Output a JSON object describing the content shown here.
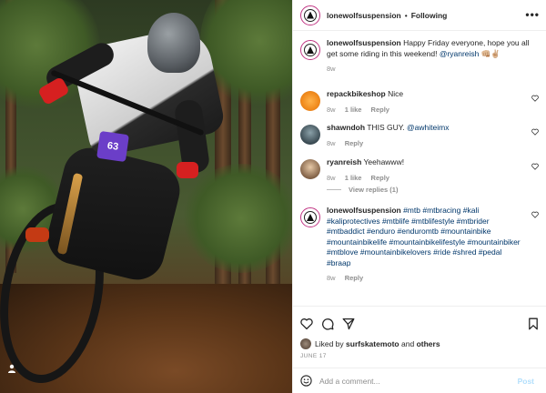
{
  "post": {
    "header": {
      "username": "lonewolfsuspension",
      "separator": "•",
      "following_label": "Following",
      "more_icon": "more-dots-icon"
    },
    "caption": {
      "username": "lonewolfsuspension",
      "text": "Happy Friday everyone, hope you all get some riding in this weekend!",
      "mention": "@ryanreish",
      "emoji": "👊🏼✌🏼",
      "age": "8w"
    },
    "comments": [
      {
        "username": "repackbikeshop",
        "text": "Nice",
        "age": "8w",
        "likes": "1 like",
        "reply": "Reply"
      },
      {
        "username": "shawndoh",
        "text": "THIS GUY.",
        "mention": "@awhiteimx",
        "age": "8w",
        "reply": "Reply"
      },
      {
        "username": "ryanreish",
        "text": "Yeehawww!",
        "age": "8w",
        "likes": "1 like",
        "reply": "Reply"
      }
    ],
    "view_replies": "View replies (1)",
    "hashtag_comment": {
      "username": "lonewolfsuspension",
      "text": "#mtb #mtbracing #kali #kaliprotectives #mtblife #mtblifestyle #mtbrider #mtbaddict #enduro #enduromtb #mountainbike #mountainbikelife #mountainbikelifestyle #mountainbiker #mtblove #mountainbikelovers #ride #shred #pedal #braap",
      "age": "8w",
      "reply": "Reply"
    },
    "liked_by": {
      "prefix": "Liked by",
      "user": "surfskatemoto",
      "and": "and",
      "others": "others"
    },
    "date": "JUNE 17",
    "add_comment": {
      "placeholder": "Add a comment...",
      "post_label": "Post"
    },
    "photo": {
      "plate_text": "63"
    }
  },
  "colors": {
    "link": "#00376b",
    "muted": "#8e8e8e",
    "post_disabled": "#b2dffc",
    "brand_ring": "#c13584"
  }
}
